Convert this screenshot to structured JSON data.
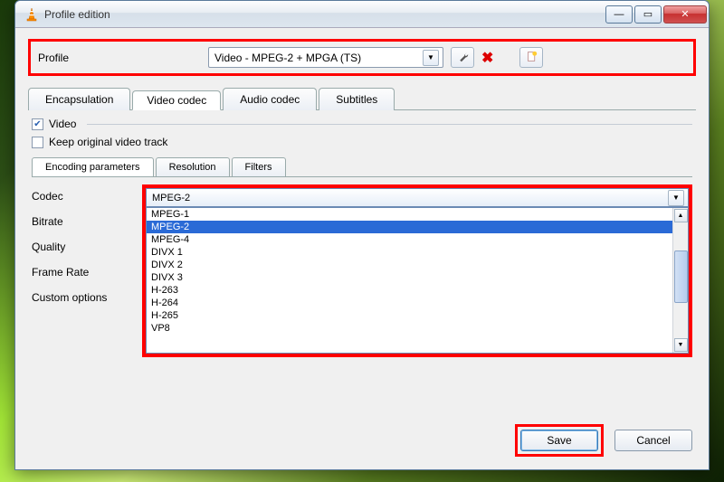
{
  "window": {
    "title": "Profile edition"
  },
  "profile": {
    "label": "Profile",
    "selected": "Video - MPEG-2 + MPGA (TS)"
  },
  "tabs": {
    "encapsulation": "Encapsulation",
    "video_codec": "Video codec",
    "audio_codec": "Audio codec",
    "subtitles": "Subtitles"
  },
  "video_group": {
    "video_check": "Video",
    "keep_original": "Keep original video track"
  },
  "subtabs": {
    "encoding": "Encoding parameters",
    "resolution": "Resolution",
    "filters": "Filters"
  },
  "params": {
    "codec": "Codec",
    "bitrate": "Bitrate",
    "quality": "Quality",
    "framerate": "Frame Rate",
    "custom": "Custom options"
  },
  "codec": {
    "selected": "MPEG-2",
    "options": [
      "MPEG-1",
      "MPEG-2",
      "MPEG-4",
      "DIVX 1",
      "DIVX 2",
      "DIVX 3",
      "H-263",
      "H-264",
      "H-265",
      "VP8"
    ]
  },
  "buttons": {
    "save": "Save",
    "cancel": "Cancel"
  }
}
